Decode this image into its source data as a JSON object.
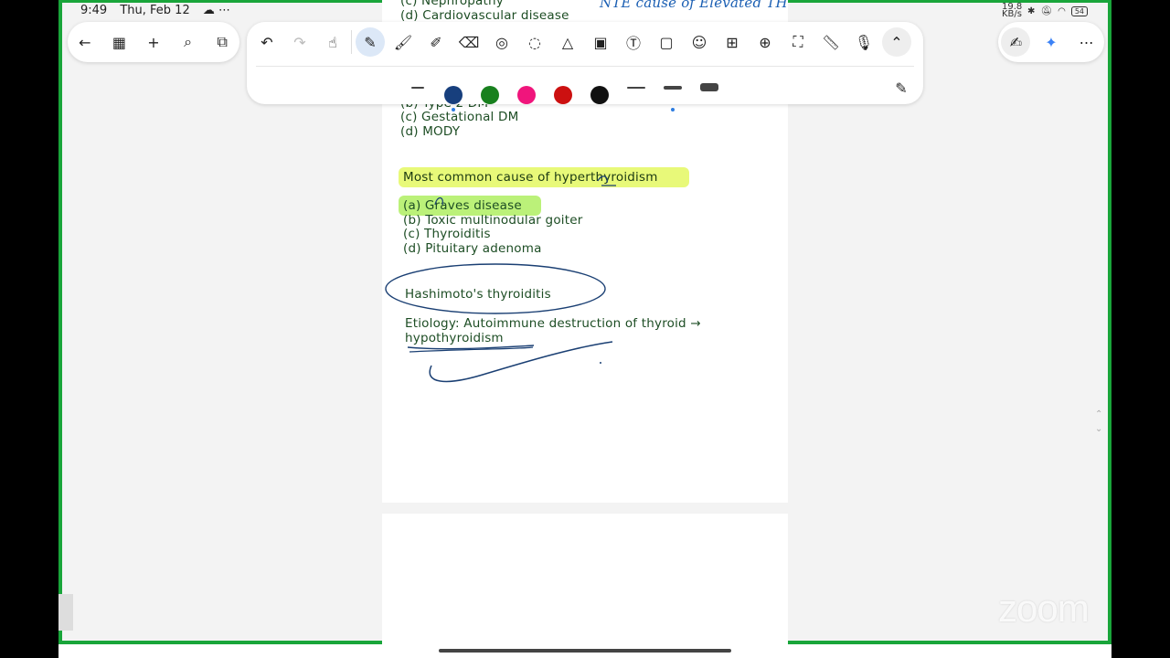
{
  "status_bar": {
    "time": "9:49",
    "date": "Thu, Feb 12",
    "net_speed": "19.8 KB/s",
    "battery": "54"
  },
  "toolbar_left": [
    "back-icon",
    "grid-icon",
    "add-icon",
    "search-icon",
    "pages-icon"
  ],
  "toolbar_main": [
    "undo-icon",
    "redo-icon",
    "select-icon",
    "pen-icon",
    "brush-icon",
    "highlighter-icon",
    "eraser-icon",
    "shape-icon",
    "lasso-icon",
    "shapes-icon",
    "image-icon",
    "text-box-icon",
    "sticky-note-icon",
    "sticker-icon",
    "table-icon",
    "zoom-icon",
    "chart-icon",
    "ruler-icon",
    "mic-icon",
    "collapse-icon"
  ],
  "colors": [
    "#173f7d",
    "#18801e",
    "#f0157c",
    "#cc1010",
    "#111111"
  ],
  "note": {
    "top_lines": [
      "(c) Nephropathy",
      "(d) Cardiovascular disease"
    ],
    "prev_options": [
      "(b) Type 2 DM",
      "(c) Gestational DM",
      "(d) MODY"
    ],
    "question": "Most common cause of hyperthyroidism",
    "options": [
      "(a) Graves disease",
      "(b) Toxic multinodular goiter",
      "(c) Thyroiditis",
      "(d) Pituitary adenoma"
    ],
    "topic": "Hashimoto's thyroiditis",
    "etiology_line1": "Etiology: Autoimmune destruction of thyroid →",
    "etiology_line2": "hypothyroidism",
    "handwritten": "NTE cause of Elevated TH"
  },
  "watermark": "zoom"
}
